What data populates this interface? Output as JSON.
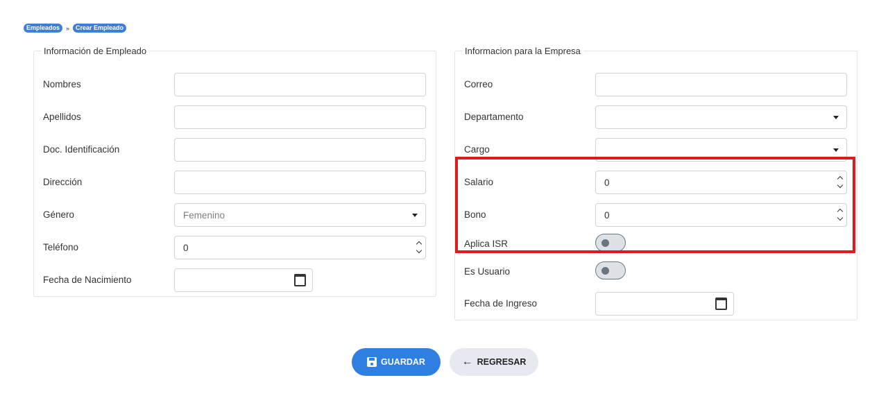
{
  "breadcrumb": {
    "items": [
      "Empleados",
      "Crear Empleado"
    ],
    "separator": "»"
  },
  "employee_section": {
    "legend": "Información de Empleado",
    "fields": {
      "nombres": {
        "label": "Nombres",
        "value": ""
      },
      "apellidos": {
        "label": "Apellidos",
        "value": ""
      },
      "doc": {
        "label": "Doc. Identificación",
        "value": ""
      },
      "direccion": {
        "label": "Dirección",
        "value": ""
      },
      "genero": {
        "label": "Género",
        "value": "Femenino"
      },
      "telefono": {
        "label": "Teléfono",
        "value": "0"
      },
      "fecha_nacimiento": {
        "label": "Fecha de Nacimiento",
        "value": ""
      }
    }
  },
  "company_section": {
    "legend": "Informacion para la Empresa",
    "fields": {
      "correo": {
        "label": "Correo",
        "value": ""
      },
      "departamento": {
        "label": "Departamento",
        "value": ""
      },
      "cargo": {
        "label": "Cargo",
        "value": ""
      },
      "salario": {
        "label": "Salario",
        "value": "0"
      },
      "bono": {
        "label": "Bono",
        "value": "0"
      },
      "aplica_isr": {
        "label": "Aplica ISR",
        "checked": false
      },
      "es_usuario": {
        "label": "Es Usuario",
        "checked": false
      },
      "fecha_ingreso": {
        "label": "Fecha de Ingreso",
        "value": ""
      }
    }
  },
  "actions": {
    "save_label": "GUARDAR",
    "back_label": "REGRESAR"
  },
  "icons": {
    "save": "floppy-disk-icon",
    "back": "arrow-left-icon",
    "calendar": "calendar-icon",
    "dropdown": "caret-down-icon"
  },
  "colors": {
    "accent": "#2f7fe3",
    "highlight": "#dc1c1c",
    "back_button": "#e6eaf0"
  }
}
